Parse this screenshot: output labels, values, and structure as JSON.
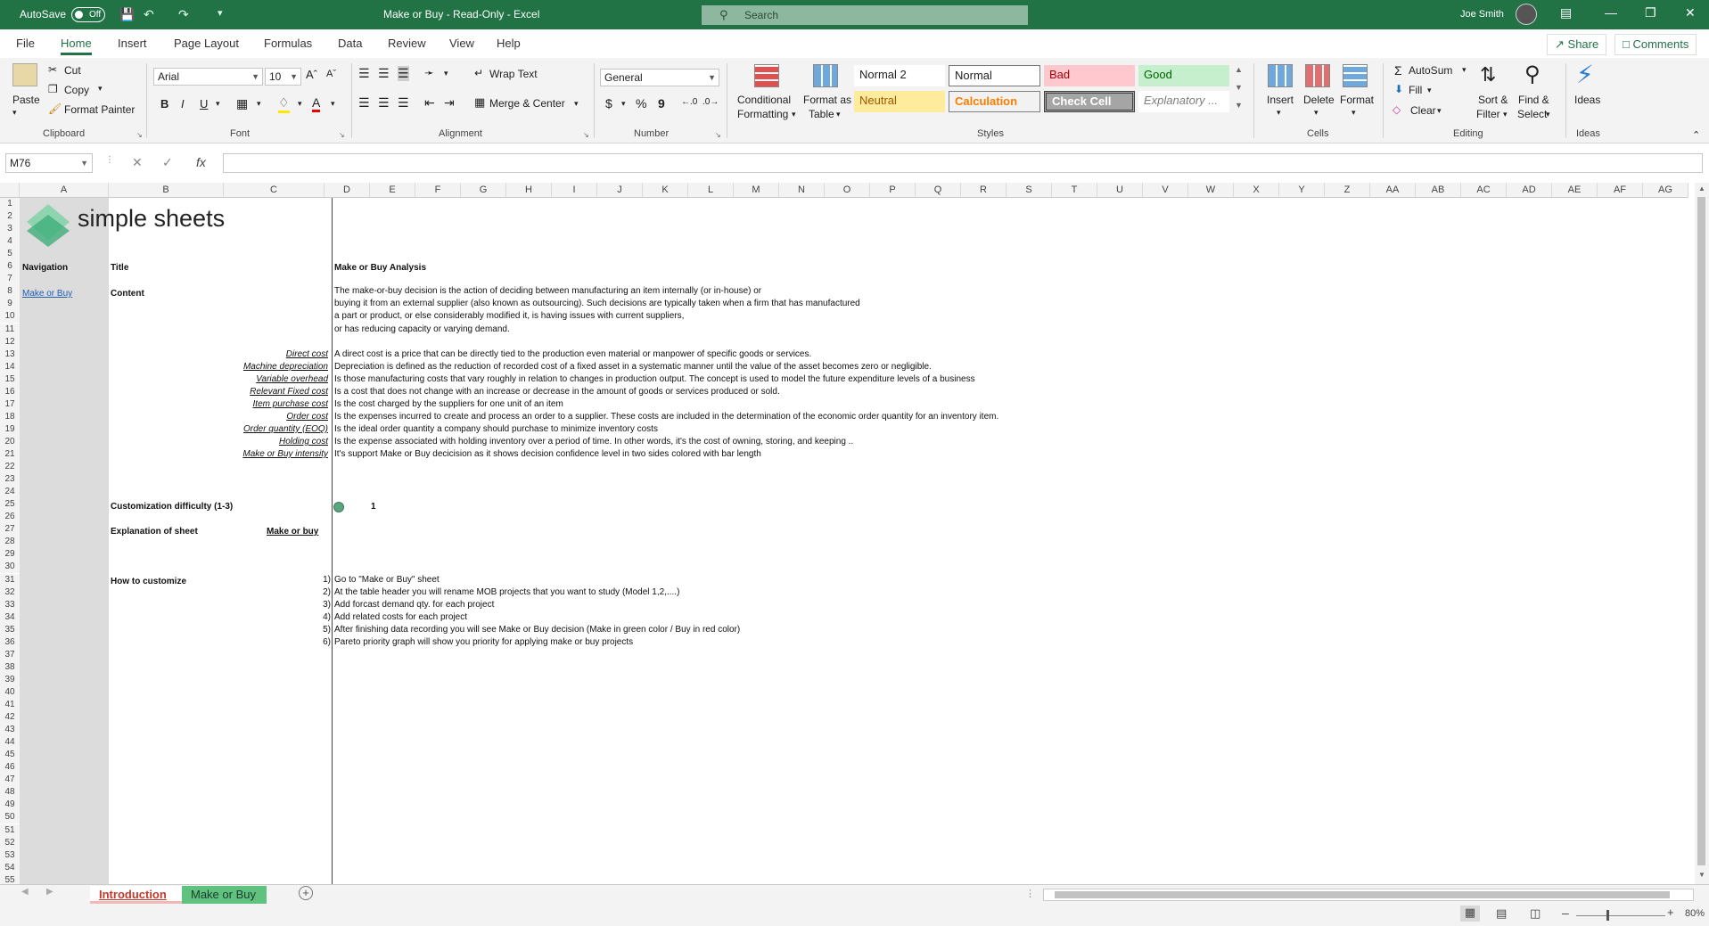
{
  "titlebar": {
    "autosave_label": "AutoSave",
    "autosave_state": "Off",
    "doc_title": "Make or Buy  -  Read-Only  -  Excel",
    "search_placeholder": "Search",
    "user_name": "Joe Smith"
  },
  "menu": {
    "tabs": [
      "File",
      "Home",
      "Insert",
      "Page Layout",
      "Formulas",
      "Data",
      "Review",
      "View",
      "Help"
    ],
    "active": "Home",
    "share": "Share",
    "comments": "Comments"
  },
  "ribbon": {
    "clipboard": {
      "paste": "Paste",
      "cut": "Cut",
      "copy": "Copy",
      "format_painter": "Format Painter",
      "label": "Clipboard"
    },
    "font": {
      "name": "Arial",
      "size": "10",
      "label": "Font",
      "bold": "B",
      "italic": "I",
      "underline": "U"
    },
    "alignment": {
      "wrap": "Wrap Text",
      "merge": "Merge & Center",
      "label": "Alignment"
    },
    "number": {
      "format": "General",
      "label": "Number",
      "dollar": "$",
      "percent": "%",
      "comma": "9"
    },
    "styles": {
      "conditional": "Conditional",
      "conditional2": "Formatting",
      "format_as": "Format as",
      "table": "Table",
      "label": "Styles",
      "cells": [
        "Normal 2",
        "Normal",
        "Bad",
        "Good",
        "Neutral",
        "Calculation",
        "Check Cell",
        "Explanatory ..."
      ]
    },
    "cells": {
      "insert": "Insert",
      "delete": "Delete",
      "format": "Format",
      "label": "Cells"
    },
    "editing": {
      "autosum": "AutoSum",
      "fill": "Fill",
      "clear": "Clear",
      "sort": "Sort &",
      "sort2": "Filter",
      "find": "Find &",
      "find2": "Select",
      "label": "Editing"
    },
    "ideas": {
      "ideas": "Ideas",
      "label": "Ideas"
    }
  },
  "formula": {
    "namebox": "M76",
    "fx": "fx"
  },
  "columns": [
    "A",
    "B",
    "C",
    "D",
    "E",
    "F",
    "G",
    "H",
    "I",
    "J",
    "K",
    "L",
    "M",
    "N",
    "O",
    "P",
    "Q",
    "R",
    "S",
    "T",
    "U",
    "V",
    "W",
    "X",
    "Y",
    "Z",
    "AA",
    "AB",
    "AC",
    "AD",
    "AE",
    "AF",
    "AG"
  ],
  "sheet": {
    "logo_text": "simple sheets",
    "navigation": "Navigation",
    "nav_link": "Make or Buy",
    "title_label": "Title",
    "title_value": "Make or Buy Analysis",
    "content_label": "Content",
    "content_lines": [
      "The make-or-buy decision is the action of deciding between manufacturing an item internally (or in-house) or",
      "buying it from an external supplier (also known as outsourcing). Such decisions are typically taken when a firm that has manufactured",
      "a part or product, or else considerably modified it, is having issues with current suppliers,",
      "or has reducing capacity or varying demand."
    ],
    "definitions": [
      {
        "term": "Direct cost",
        "text": "A direct cost is a price that can be directly tied to the production even material or manpower of specific goods or services."
      },
      {
        "term": "Machine depreciation",
        "text": "Depreciation is defined as the reduction of recorded cost of a fixed asset in a systematic manner until the value of the asset becomes zero or negligible."
      },
      {
        "term": "Variable overhead",
        "text": "Is those manufacturing costs that vary roughly in relation to changes in production output. The concept is used to model the future expenditure levels of a business"
      },
      {
        "term": "Relevant Fixed cost",
        "text": "Is a cost that does not change with an increase or decrease in the amount of goods or services produced or sold."
      },
      {
        "term": "Item purchase cost",
        "text": "Is the cost charged by the suppliers for one unit of an item"
      },
      {
        "term": "Order cost",
        "text": "Is the expenses incurred to create and process an order to a supplier. These costs are included in the determination of the economic order quantity for an inventory item."
      },
      {
        "term": "Order quantity (EOQ)",
        "text": "Is the ideal order quantity a company should purchase to minimize inventory costs"
      },
      {
        "term": "Holding cost",
        "text": "Is the expense associated with holding inventory over a period of time. In other words, it's the cost of owning, storing, and keeping .."
      },
      {
        "term": "Make or Buy intensity",
        "text": "It's support Make or Buy decicision as it shows decision confidence level in two sides colored with bar length"
      }
    ],
    "difficulty_label": "Customization difficulty (1-3)",
    "difficulty_value": "1",
    "explanation_label": "Explanation of sheet",
    "explanation_link": "Make or buy",
    "howto_label": "How to customize",
    "steps": [
      {
        "n": "1)",
        "text": "Go to \"Make or Buy\" sheet"
      },
      {
        "n": "2)",
        "text": "At the table header you will rename MOB projects that you want to study (Model 1,2,....)"
      },
      {
        "n": "3)",
        "text": "Add forcast demand qty. for each project"
      },
      {
        "n": "4)",
        "text": "Add related costs for each project"
      },
      {
        "n": "5)",
        "text": "After finishing data recording you will see Make or Buy decision (Make in green color / Buy in red color)"
      },
      {
        "n": "6)",
        "text": "Pareto priority graph will show you priority for applying make or buy projects"
      }
    ]
  },
  "tabs": {
    "sheet1": "Introduction",
    "sheet2": "Make or Buy"
  },
  "status": {
    "zoom": "80%"
  },
  "colors": {
    "excel_green": "#217346",
    "tab_intro": "#f4b6b6",
    "tab_mob": "#5fc27e"
  }
}
